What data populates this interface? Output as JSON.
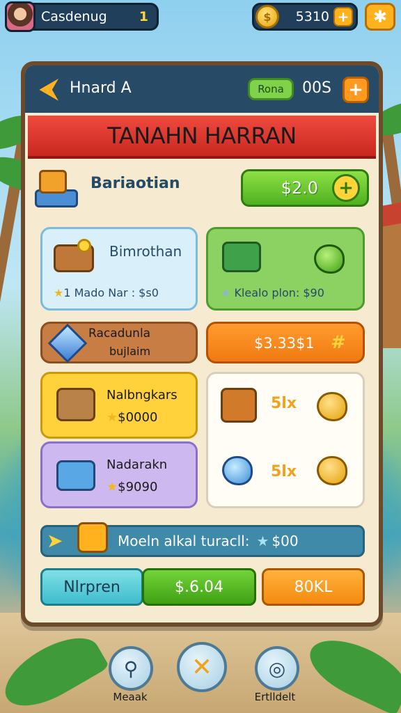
{
  "hud": {
    "player_name": "Casdenug",
    "player_level": "1",
    "coins": "5310",
    "coin_symbol": "$",
    "plus": "+",
    "settings": "✱"
  },
  "panel": {
    "back": "⮜",
    "title": "Hnard A",
    "badge": "Rona",
    "count": "00S",
    "plus": "+",
    "banner": "TANAHN HARRAN"
  },
  "offer": {
    "label": "Bariaotian",
    "price": "$2.0",
    "plus": "+"
  },
  "cards": [
    {
      "title": "Bimrothan",
      "meta_prefix": "1",
      "meta": "Mado Nar : $s0"
    },
    {
      "title": "",
      "meta": "Klealo plon: $90"
    },
    {
      "title": "Racadunla",
      "subtitle": "bujlaim"
    },
    {
      "price": "$3.33$1",
      "plus": "#"
    },
    {
      "title": "Nalbngkars",
      "meta": "$0000"
    },
    {
      "title": "Nadarakn",
      "meta": "$9090"
    }
  ],
  "trades": [
    {
      "amount": "5lx"
    },
    {
      "amount": "5lx"
    }
  ],
  "info_bar": {
    "text": "Moeln alkal turacll:",
    "value": "$00"
  },
  "bottom_buttons": {
    "left": "Nlrpren",
    "middle": "$.6.04",
    "right": "80KL"
  },
  "dock": {
    "left_label": "Meaak",
    "center_icon": "✕",
    "right_label": "Ertlldelt"
  },
  "colors": {
    "accent_orange": "#ff9a1e",
    "header_navy": "#274a66",
    "banner_red": "#e03a30",
    "price_green": "#4fb11f"
  }
}
